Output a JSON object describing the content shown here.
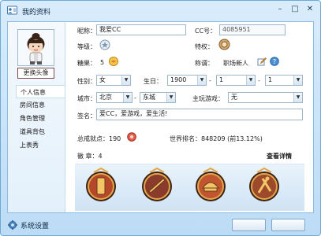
{
  "window": {
    "title": "我的资料",
    "controls": [
      "minimize-icon",
      "maximize-icon",
      "close-icon"
    ]
  },
  "sidebar": {
    "change_avatar": "更换头像",
    "items": [
      {
        "label": "个人信息",
        "active": true
      },
      {
        "label": "房间信息",
        "active": false
      },
      {
        "label": "角色管理",
        "active": false
      },
      {
        "label": "道具背包",
        "active": false
      },
      {
        "label": "上表秀",
        "active": false
      }
    ]
  },
  "profile": {
    "nickname_label": "昵称：",
    "nickname_value": "我爱CC",
    "cc_label": "CC号：",
    "cc_value": "4085951",
    "level_label": "等级：",
    "privilege_label": "特权：",
    "candy_label": "糖果：",
    "candy_value": "5",
    "title_label": "称谓：",
    "title_value": "职场新人",
    "gender_label": "性别：",
    "gender_value": "女",
    "birthday_label": "生日：",
    "birth_year": "1900",
    "birth_month": "1",
    "birth_day": "1",
    "city_label": "城市：",
    "province_value": "北京",
    "district_value": "东城",
    "main_game_label": "主玩游戏：",
    "main_game_value": "无",
    "signature_label": "签名：",
    "signature_value": "爱CC，爱游戏，爱生活!",
    "popularity_text": "总戒就点：190",
    "world_rank_text": "世界排名：848209 (前13.12%)",
    "medals_label": "徽      章：4",
    "view_details": "查看详情"
  },
  "medals": [
    {
      "name": "medal-1",
      "color": "#b5482a"
    },
    {
      "name": "medal-2",
      "color": "#8a3b2c"
    },
    {
      "name": "medal-3",
      "color": "#c0552f"
    },
    {
      "name": "medal-4",
      "color": "#9c4a2b"
    }
  ],
  "footer": {
    "settings_label": "系统设置"
  },
  "colors": {
    "accent": "#6fa9d6",
    "panel": "#cfe3f4"
  }
}
